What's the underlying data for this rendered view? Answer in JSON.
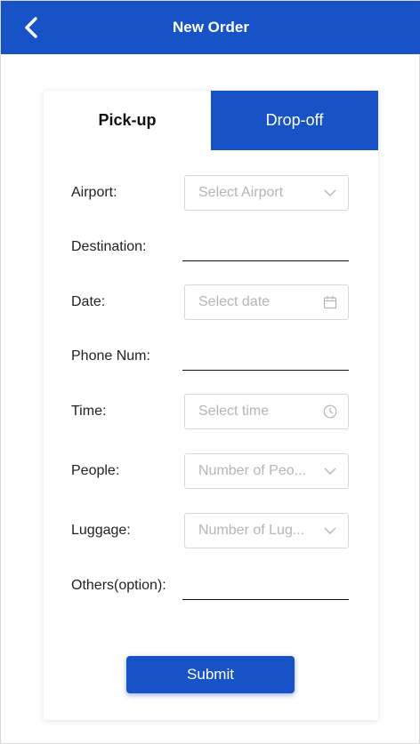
{
  "header": {
    "title": "New Order",
    "back_icon": "chevron-left-icon"
  },
  "tabs": [
    {
      "label": "Pick-up",
      "active": true
    },
    {
      "label": "Drop-off",
      "active": false
    }
  ],
  "form": {
    "airport": {
      "label": "Airport:",
      "placeholder": "Select Airport",
      "icon": "chevron-down-icon"
    },
    "destination": {
      "label": "Destination:",
      "value": ""
    },
    "date": {
      "label": "Date:",
      "placeholder": "Select date",
      "icon": "calendar-icon"
    },
    "phone": {
      "label": "Phone Num:",
      "value": ""
    },
    "time": {
      "label": "Time:",
      "placeholder": "Select time",
      "icon": "clock-icon"
    },
    "people": {
      "label": "People:",
      "placeholder": "Number of Peo...",
      "icon": "chevron-down-icon"
    },
    "luggage": {
      "label": "Luggage:",
      "placeholder": "Number of Lug...",
      "icon": "chevron-down-icon"
    },
    "others": {
      "label": "Others(option):",
      "value": ""
    }
  },
  "submit_label": "Submit",
  "colors": {
    "primary": "#1753c6",
    "border": "#d9d9d9",
    "placeholder": "#b5b5b5"
  }
}
